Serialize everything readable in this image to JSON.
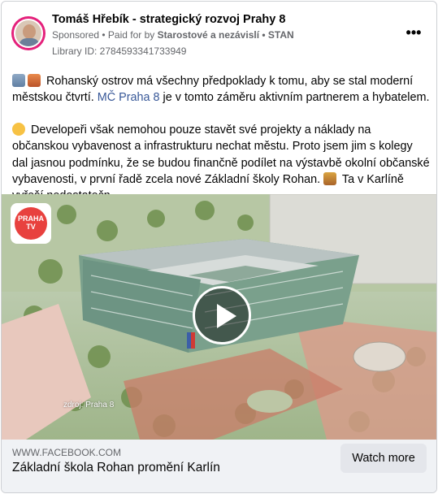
{
  "post": {
    "page_name": "Tomáš Hřebík - strategický rozvoj Prahy 8",
    "sponsored": "Sponsored",
    "paid_for_prefix": "• Paid for by",
    "paid_for_by": "Starostové a nezávislí • STAN",
    "library_id": "Library ID: 2784593341733949",
    "more_label": "•••"
  },
  "body": {
    "p1_text": "Rohanský ostrov má všechny předpoklady k tomu, aby se stal moderní městskou čtvrtí.",
    "p1_link": "MČ Praha 8",
    "p1_tail": "je v tomto záměru aktivním partnerem a hybatelem.",
    "p2_text": "Developeři však nemohou pouze stavět své projekty a náklady na občanskou vybavenost a infrastrukturu nechat městu. Proto jsem jim s kolegy dal jasnou podmínku, že se budou finančně podílet na výstavbě okolní občanské vybavenosti, v první řadě zcela nové Základní školy Rohan.",
    "p2_tail": "Ta v Karlíně vyřeší nedostatečn..."
  },
  "media": {
    "badge_line1": "PRAHA",
    "badge_line2": "TV",
    "source_caption": "zdroj: Praha 8"
  },
  "footer": {
    "domain": "WWW.FACEBOOK.COM",
    "title": "Základní škola Rohan promění Karlín",
    "cta_label": "Watch more"
  }
}
